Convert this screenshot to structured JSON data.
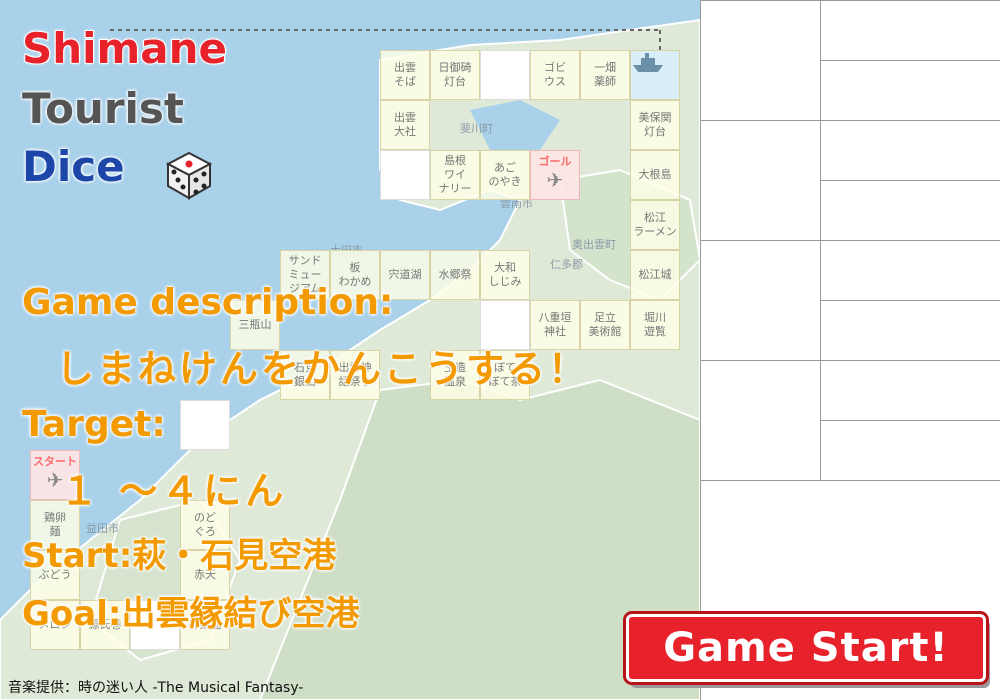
{
  "title": {
    "line1": "Shimane",
    "line2": "Tourist",
    "line3": "Dice"
  },
  "description": {
    "label": "Game description:",
    "text": "しまねけんをかんこうする！"
  },
  "target": {
    "label": "Target:",
    "value": "１ ～４にん"
  },
  "start": {
    "label": "Start:",
    "value": "萩・石見空港"
  },
  "goal": {
    "label": "Goal:",
    "value": "出雲縁結び空港"
  },
  "start_button": {
    "label": "Game Start!"
  },
  "credit": "音楽提供：時の迷い人 -The Musical Fantasy-",
  "board": {
    "goal_label": "ゴール",
    "start_label": "スタート",
    "cells": [
      {
        "name": "izumo-soba",
        "label": "出雲\nそば"
      },
      {
        "name": "hinomisaki",
        "label": "日御碕\n灯台"
      },
      {
        "name": "blank-a",
        "label": ""
      },
      {
        "name": "gobiusu",
        "label": "ゴビ\nウス"
      },
      {
        "name": "ichibata",
        "label": "一畑\n薬師"
      },
      {
        "name": "ship-1",
        "label": ""
      },
      {
        "name": "izumo-taisha",
        "label": "出雲\n大社"
      },
      {
        "name": "mihonoseki",
        "label": "美保関\n灯台"
      },
      {
        "name": "blank-b",
        "label": ""
      },
      {
        "name": "shimane-winery",
        "label": "島根\nワイ\nナリー"
      },
      {
        "name": "ago-noyaki",
        "label": "あご\nのやき"
      },
      {
        "name": "goal",
        "label": ""
      },
      {
        "name": "daikonshima",
        "label": "大根島"
      },
      {
        "name": "matsue-ramen",
        "label": "松江\nラーメン"
      },
      {
        "name": "sand-museum",
        "label": "サンド\nミュー\nジアム"
      },
      {
        "name": "ita-wakame",
        "label": "板\nわかめ"
      },
      {
        "name": "shinjiko",
        "label": "宍道湖"
      },
      {
        "name": "suigosai",
        "label": "水郷祭"
      },
      {
        "name": "yamato-shijimi",
        "label": "大和\nしじみ"
      },
      {
        "name": "matsue-castle",
        "label": "松江城"
      },
      {
        "name": "yaegaki",
        "label": "八重垣\n神社"
      },
      {
        "name": "adachi",
        "label": "足立\n美術館"
      },
      {
        "name": "horikawa",
        "label": "堀川\n遊覧"
      },
      {
        "name": "blank-c",
        "label": ""
      },
      {
        "name": "sanbe",
        "label": "三瓶山"
      },
      {
        "name": "iwami-ginzan",
        "label": "石見\n銀山"
      },
      {
        "name": "izumo-kagura",
        "label": "出雲神\n話祭り"
      },
      {
        "name": "tamatsukuri",
        "label": "玉造\n温泉"
      },
      {
        "name": "botebote",
        "label": "ぼて\nぼて茶"
      },
      {
        "name": "blank-d",
        "label": ""
      },
      {
        "name": "start",
        "label": ""
      },
      {
        "name": "tori-tamago",
        "label": "鶏卵\n麺"
      },
      {
        "name": "nodoguro",
        "label": "のど\nぐろ"
      },
      {
        "name": "budou",
        "label": "ぶどう"
      },
      {
        "name": "akaten",
        "label": "赤天"
      },
      {
        "name": "melon",
        "label": "メロン"
      },
      {
        "name": "genjimaki",
        "label": "源氏巻"
      },
      {
        "name": "blank-e",
        "label": ""
      },
      {
        "name": "jinrakumen",
        "label": "神楽面"
      }
    ]
  },
  "map_labels": [
    "斐川町",
    "雲南市",
    "奥出雲町",
    "仁多郡",
    "大田市",
    "益田市"
  ],
  "colors": {
    "red": "#e8222a",
    "gray": "#555555",
    "blue": "#1c47a8",
    "orange": "#f39a00",
    "sea": "#a9d1ea"
  }
}
